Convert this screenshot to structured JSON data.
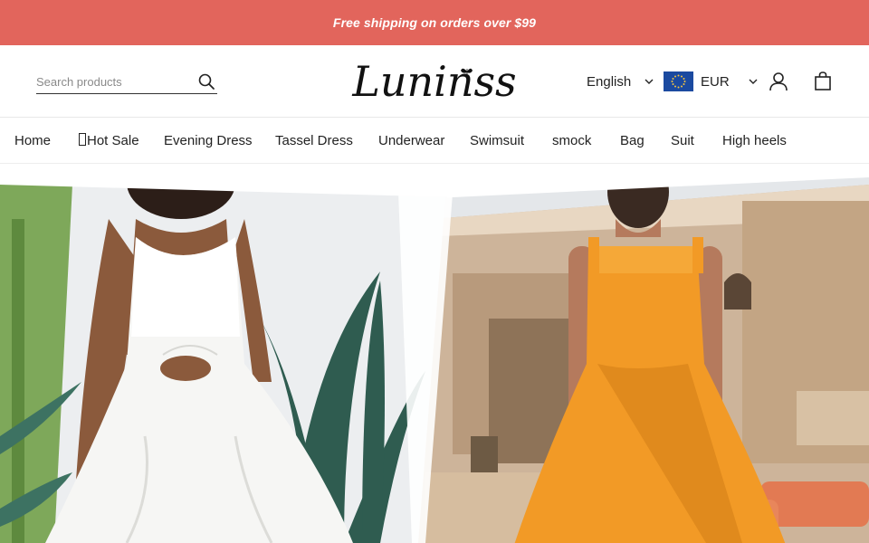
{
  "announcement": {
    "text": "Free shipping on orders over $99"
  },
  "header": {
    "search": {
      "placeholder": "Search products",
      "value": ""
    },
    "logo": {
      "text": "Luninss"
    },
    "language": {
      "selected": "English"
    },
    "currency": {
      "selected": "EUR"
    }
  },
  "nav": {
    "items": [
      {
        "label": "Home"
      },
      {
        "label": "Hot Sale"
      },
      {
        "label": "Evening Dress"
      },
      {
        "label": "Tassel Dress"
      },
      {
        "label": "Underwear"
      },
      {
        "label": "Swimsuit"
      },
      {
        "label": "smock"
      },
      {
        "label": "Bag"
      },
      {
        "label": "Suit"
      },
      {
        "label": "High heels"
      }
    ]
  },
  "colors": {
    "announcement_bg": "#e2655c",
    "flag_bg": "#1b4aa0",
    "flag_stars": "#f4c542",
    "dress_orange": "#f29a26"
  },
  "icons": [
    "search-icon",
    "chevron-down-icon",
    "eu-flag-icon",
    "user-icon",
    "shopping-bag-icon",
    "butterfly-icon"
  ]
}
